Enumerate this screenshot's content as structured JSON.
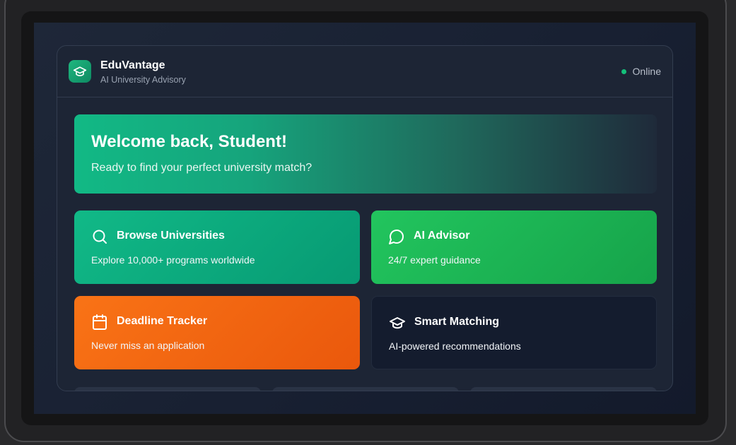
{
  "app": {
    "name": "EduVantage",
    "subtitle": "AI University Advisory",
    "logo_icon": "graduation-cap-icon",
    "status": "Online",
    "status_color": "#14c07a"
  },
  "welcome": {
    "title": "Welcome back, Student!",
    "subtitle": "Ready to find your perfect university match?"
  },
  "cards": [
    {
      "title": "Browse Universities",
      "description": "Explore 10,000+ programs worldwide",
      "icon": "search-icon",
      "color": "#10b981"
    },
    {
      "title": "AI Advisor",
      "description": "24/7 expert guidance",
      "icon": "chat-bubble-icon",
      "color": "#22c55e"
    },
    {
      "title": "Deadline Tracker",
      "description": "Never miss an application",
      "icon": "calendar-icon",
      "color": "#f97316"
    },
    {
      "title": "Smart Matching",
      "description": "AI-powered recommendations",
      "icon": "graduation-cap-icon",
      "color": "#141c2e"
    }
  ]
}
